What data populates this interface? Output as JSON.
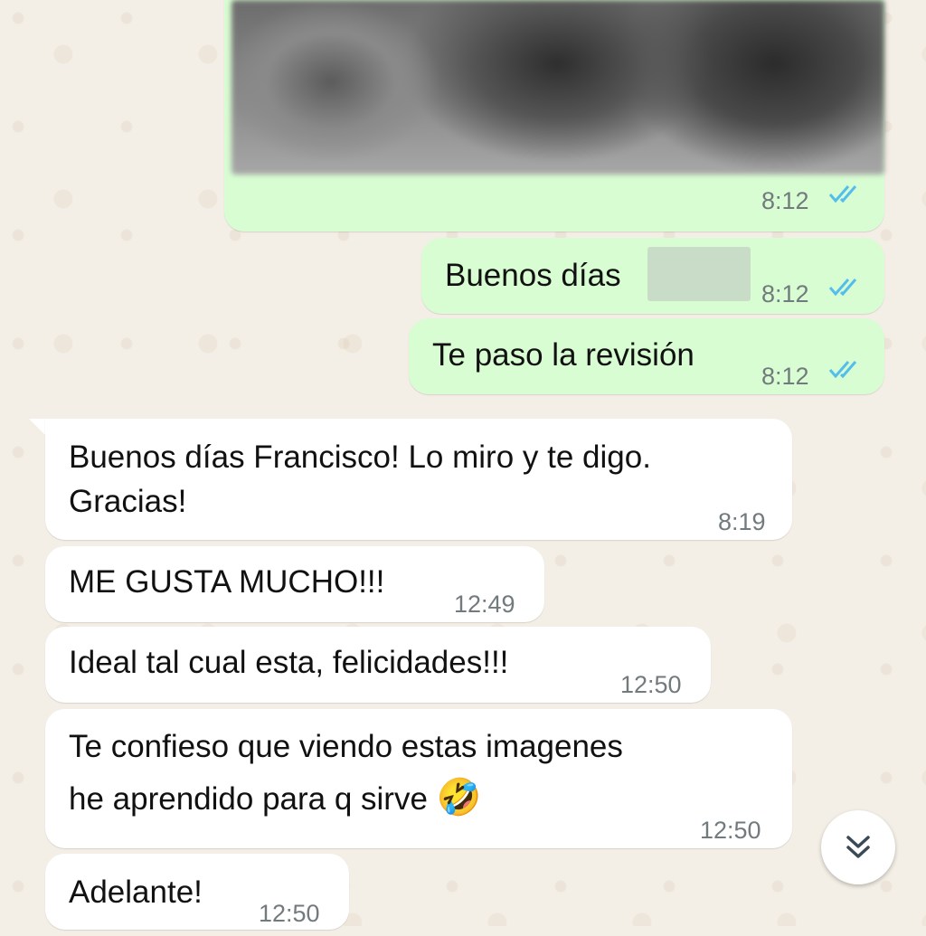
{
  "chat": {
    "messages": [
      {
        "direction": "outgoing",
        "type": "image",
        "time": "8:12",
        "status": "read"
      },
      {
        "direction": "outgoing",
        "text": "Buenos días",
        "time": "8:12",
        "status": "read"
      },
      {
        "direction": "outgoing",
        "text": "Te paso la revisión",
        "time": "8:12",
        "status": "read"
      },
      {
        "direction": "incoming",
        "lines": [
          "Buenos días Francisco! Lo miro y te digo.",
          "Gracias!"
        ],
        "time": "8:19"
      },
      {
        "direction": "incoming",
        "text": "ME GUSTA MUCHO!!!",
        "time": "12:49"
      },
      {
        "direction": "incoming",
        "text": "Ideal tal cual esta, felicidades!!!",
        "time": "12:50"
      },
      {
        "direction": "incoming",
        "lines": [
          "Te confieso que viendo estas imagenes",
          "he aprendido para q sirve"
        ],
        "emoji": "🤣",
        "time": "12:50"
      },
      {
        "direction": "incoming",
        "text": "Adelante!",
        "time": "12:50"
      }
    ]
  },
  "scroll_button": {
    "icon": "double-chevron-down-icon"
  },
  "colors": {
    "outgoing_bubble": "#d9fdd3",
    "incoming_bubble": "#ffffff",
    "read_ticks": "#53bdeb",
    "background": "#f4efe6"
  }
}
